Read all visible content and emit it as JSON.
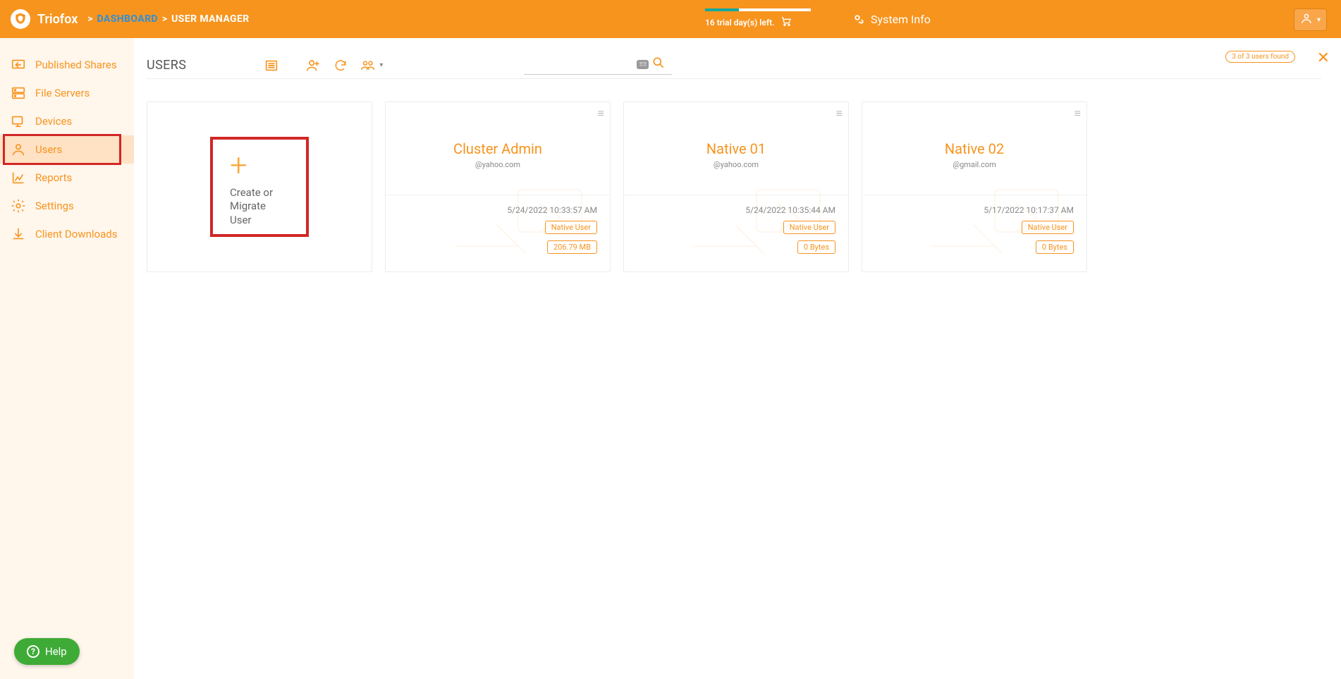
{
  "header": {
    "brand": "Triofox",
    "sep": ">",
    "bc1": "DASHBOARD",
    "bc2": "USER MANAGER",
    "trial": "16 trial day(s) left.",
    "systemInfo": "System Info"
  },
  "sidebar": {
    "items": [
      {
        "label": "Published Shares"
      },
      {
        "label": "File Servers"
      },
      {
        "label": "Devices"
      },
      {
        "label": "Users"
      },
      {
        "label": "Reports"
      },
      {
        "label": "Settings"
      },
      {
        "label": "Client Downloads"
      }
    ]
  },
  "page": {
    "title": "USERS",
    "countPill": "3 of 3 users found",
    "searchPlaceholder": ""
  },
  "createCard": {
    "label": "Create or Migrate User"
  },
  "users": [
    {
      "name": "Cluster Admin",
      "email": "@yahoo.com",
      "time": "5/24/2022 10:33:57 AM",
      "type": "Native User",
      "size": "206.79 MB"
    },
    {
      "name": "Native 01",
      "email": "@yahoo.com",
      "time": "5/24/2022 10:35:44 AM",
      "type": "Native User",
      "size": "0 Bytes"
    },
    {
      "name": "Native 02",
      "email": "@gmail.com",
      "time": "5/17/2022 10:17:37 AM",
      "type": "Native User",
      "size": "0 Bytes"
    }
  ],
  "help": {
    "label": "Help"
  }
}
